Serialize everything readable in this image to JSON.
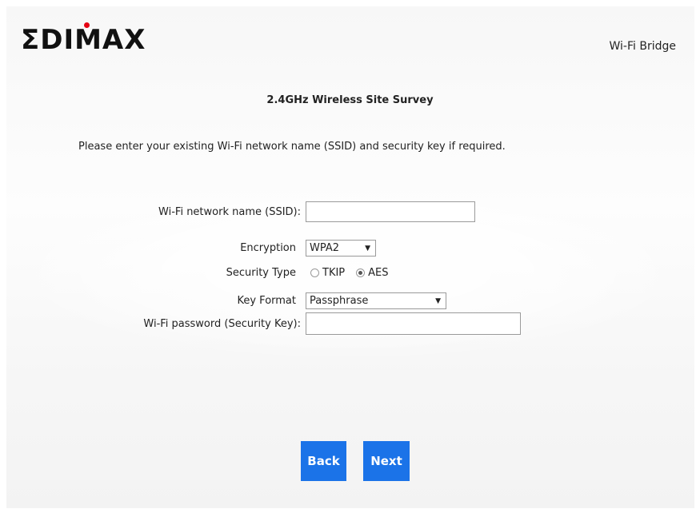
{
  "brand": {
    "logo_text": "ΣDIMAX",
    "product": "Wi-Fi Bridge",
    "dot_color": "#e50012"
  },
  "page": {
    "title": "2.4GHz  Wireless Site Survey",
    "instruction": "Please enter your existing Wi-Fi network name (SSID) and security key if required."
  },
  "form": {
    "ssid_label": "Wi-Fi network name (SSID):",
    "ssid_value": "",
    "encryption_label": "Encryption",
    "encryption_value": "WPA2",
    "security_type_label": "Security Type",
    "security_options": [
      "TKIP",
      "AES"
    ],
    "security_selected": "AES",
    "key_format_label": "Key Format",
    "key_format_value": "Passphrase",
    "password_label": "Wi-Fi password (Security Key):",
    "password_value": ""
  },
  "buttons": {
    "back": "Back",
    "next": "Next",
    "color": "#1b73e8"
  }
}
